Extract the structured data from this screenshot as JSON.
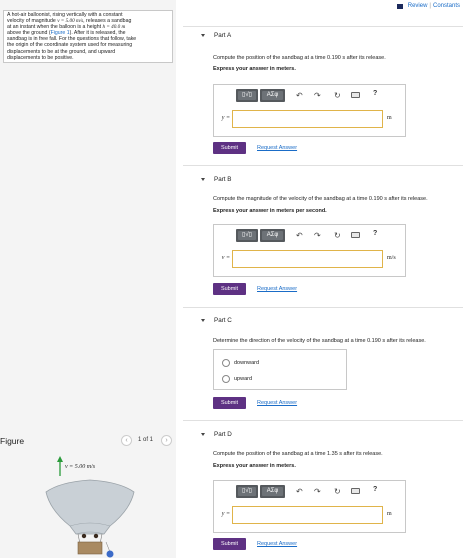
{
  "header": {
    "review": "Review",
    "separator": "|",
    "constants": "Constants"
  },
  "problem": {
    "line1": "A hot-air balloonist, rising vertically with a constant",
    "line2a": "velocity of magnitude ",
    "line2_v": "v = 5.00 m/s",
    "line2b": ", releases a sandbag",
    "line3a": "at an instant when the balloon is a height ",
    "line3_h": "h = 40.0 m",
    "line4a": "above the ground (",
    "line4_link": "Figure 1",
    "line4b": "). After it is released, the",
    "line5": "sandbag is in free fall. For the questions that follow, take",
    "line6": "the origin of the coordinate system used for measuring",
    "line7": "displacements to be at the ground, and upward",
    "line8": "displacements to be positive."
  },
  "figure": {
    "title": "Figure",
    "prev": "‹",
    "count": "1 of 1",
    "next": "›",
    "label": "v = 5.00 m/s"
  },
  "toolbar": {
    "templates": "▯√▯",
    "symbols": "ΑΣφ",
    "undo": "↶",
    "redo": "↷",
    "reset": "↻",
    "help": "?"
  },
  "parts": [
    {
      "label": "Part A",
      "question": "Compute the position of the sandbag at a time 0.190 s after its release.",
      "instruction": "Express your answer in meters.",
      "var": "y =",
      "unit": "m",
      "value": ""
    },
    {
      "label": "Part B",
      "question": "Compute the magnitude of the velocity of the sandbag at a time 0.190 s after its release.",
      "instruction": "Express your answer in meters per second.",
      "var": "v =",
      "unit": "m/s",
      "value": ""
    },
    {
      "label": "Part C",
      "question": "Determine the direction of the velocity of the sandbag at a time 0.190 s after its release.",
      "options": [
        "downward",
        "upward"
      ]
    },
    {
      "label": "Part D",
      "question": "Compute the position of the sandbag at a time 1.35 s after its release.",
      "instruction": "Express your answer in meters.",
      "var": "y =",
      "unit": "m",
      "value": ""
    }
  ],
  "buttons": {
    "submit": "Submit",
    "request": "Request Answer"
  }
}
